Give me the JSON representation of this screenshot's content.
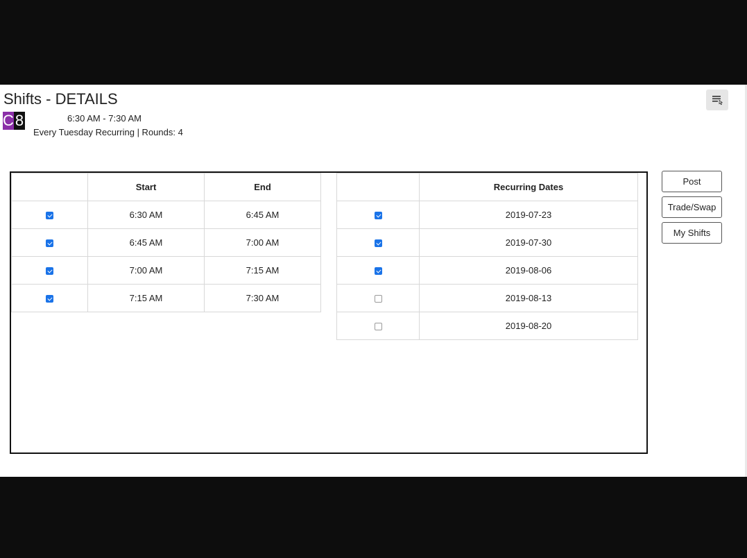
{
  "header": {
    "title": "Shifts - DETAILS",
    "badge_letter": "C",
    "badge_number": "8",
    "time_range": "6:30 AM - 7:30 AM",
    "recurrence": "Every Tuesday Recurring | Rounds: 4"
  },
  "menu": {
    "icon": "menu-list-icon"
  },
  "shift_table": {
    "columns": [
      "",
      "Start",
      "End"
    ],
    "rows": [
      {
        "checked": true,
        "start": "6:30 AM",
        "end": "6:45 AM"
      },
      {
        "checked": true,
        "start": "6:45 AM",
        "end": "7:00 AM"
      },
      {
        "checked": true,
        "start": "7:00 AM",
        "end": "7:15 AM"
      },
      {
        "checked": true,
        "start": "7:15 AM",
        "end": "7:30 AM"
      }
    ]
  },
  "dates_table": {
    "columns": [
      "",
      "Recurring Dates"
    ],
    "rows": [
      {
        "checked": true,
        "date": "2019-07-23"
      },
      {
        "checked": true,
        "date": "2019-07-30"
      },
      {
        "checked": true,
        "date": "2019-08-06"
      },
      {
        "checked": false,
        "date": "2019-08-13"
      },
      {
        "checked": false,
        "date": "2019-08-20"
      }
    ]
  },
  "actions": {
    "post": "Post",
    "trade_swap": "Trade/Swap",
    "my_shifts": "My Shifts"
  },
  "colors": {
    "badge_purple": "#8b2fa8",
    "checkbox_blue": "#1a73e8",
    "backdrop": "#0d0d0d"
  }
}
